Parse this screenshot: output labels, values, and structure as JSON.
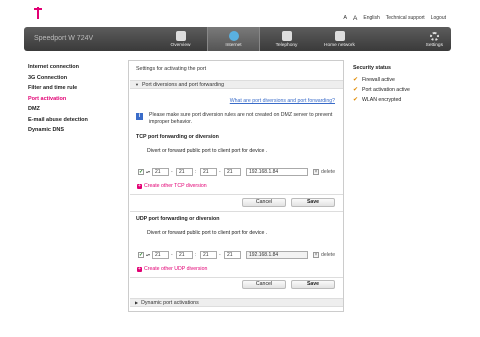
{
  "header": {
    "font_small": "A",
    "font_large": "A",
    "links": [
      "English",
      "Technical support",
      "Logout"
    ]
  },
  "navbar": {
    "brand": "Speedport W 724V",
    "tabs": [
      {
        "label": "Overview",
        "icon": "home-icon"
      },
      {
        "label": "Internet",
        "icon": "globe-icon"
      },
      {
        "label": "Telephony",
        "icon": "phone-icon"
      },
      {
        "label": "Home network",
        "icon": "network-icon"
      }
    ],
    "settings_label": "Settings"
  },
  "leftnav": {
    "items": [
      "Internet connection",
      "3G Connection",
      "Filter and time rule",
      "Port activation",
      "DMZ",
      "E-mail abuse detection",
      "Dynamic DNS"
    ],
    "active_index": 3
  },
  "panel": {
    "title": "Settings for activating the port",
    "section1": "Port diversions and port forwarding",
    "help_link": "What are port diversions and port forwarding?",
    "info": "Please make sure port diversion rules are not created on DMZ server to prevent improper behavior.",
    "tcp": {
      "title": "TCP port forwarding or diversion",
      "sub": "Divert or forward public port to client port for device .",
      "values": [
        "21",
        "21",
        "21",
        "21"
      ],
      "ip": "192.168.1.84",
      "delete": "delete",
      "create": "Create other TCP diversion",
      "cancel": "Cancel",
      "save": "Save"
    },
    "udp": {
      "title": "UDP port forwarding or diversion",
      "sub": "Divert or forward public port to client port for device .",
      "values": [
        "21",
        "21",
        "21",
        "21"
      ],
      "ip": "192.168.1.84",
      "delete": "delete",
      "create": "Create other UDP diversion",
      "cancel": "Cancel",
      "save": "Save"
    },
    "section2": "Dynamic port activations"
  },
  "security_status": {
    "title": "Security status",
    "items": [
      "Firewall active",
      "Port activation active",
      "WLAN encrypted"
    ]
  },
  "colors": {
    "accent": "#e20074",
    "link": "#3a6cc9"
  }
}
